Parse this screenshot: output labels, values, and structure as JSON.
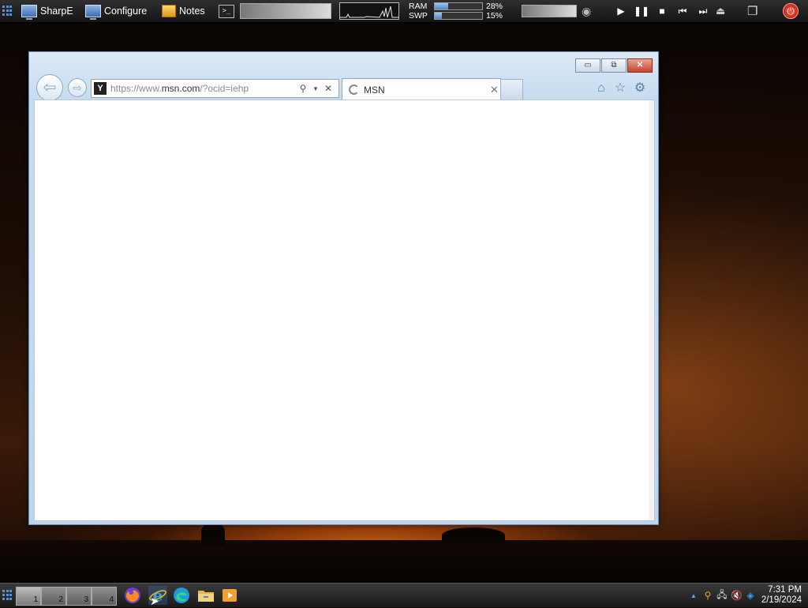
{
  "top_panel": {
    "launchers": [
      {
        "label": "SharpE",
        "icon": "monitor-icon"
      },
      {
        "label": "Configure",
        "icon": "monitor-icon"
      },
      {
        "label": "Notes",
        "icon": "notes-icon"
      }
    ],
    "terminal_glyph": ">_",
    "memory": {
      "ram_label": "RAM",
      "ram_percent": "28%",
      "ram_fraction": 0.28,
      "swp_label": "SWP",
      "swp_percent": "15%",
      "swp_fraction": 0.15
    },
    "media_controls": [
      "play-icon",
      "pause-icon",
      "stop-icon",
      "previous-icon",
      "next-icon"
    ]
  },
  "browser": {
    "address_prefix": "https://www.",
    "address_domain": "msn.com",
    "address_suffix": "/?ocid=iehp",
    "site_icon_glyph": "Y",
    "tab_title": "MSN",
    "controls": {
      "minimize": "▭",
      "restore": "⧉",
      "close": "✕"
    }
  },
  "taskbar": {
    "workspaces": [
      "1",
      "2",
      "3",
      "4"
    ],
    "apps": [
      "firefox-icon",
      "internet-explorer-icon",
      "edge-icon",
      "file-explorer-icon",
      "media-player-icon"
    ],
    "clock_time": "7:31 PM",
    "clock_date": "2/19/2024"
  },
  "colors": {
    "accent": "#4f86c9",
    "power": "#d62a18"
  }
}
